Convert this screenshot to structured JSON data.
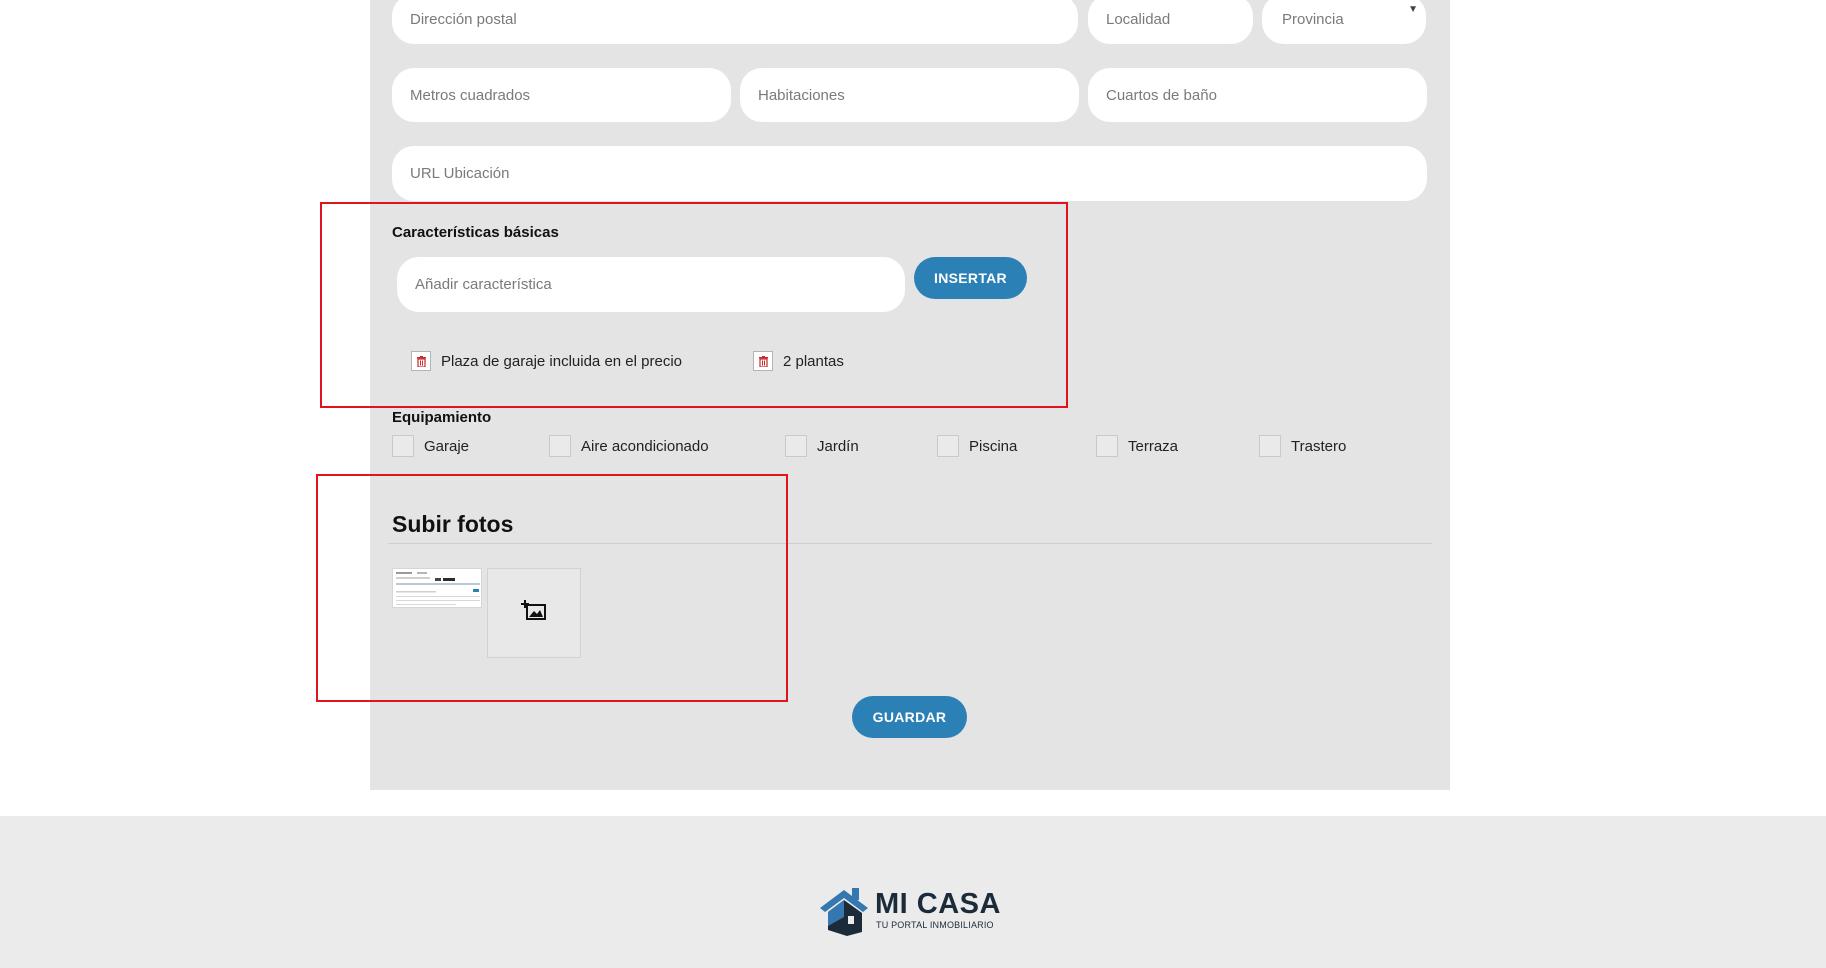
{
  "form": {
    "address_placeholder": "Dirección postal",
    "locality_placeholder": "Localidad",
    "province_selected": "Provincia",
    "sqm_placeholder": "Metros cuadrados",
    "rooms_placeholder": "Habitaciones",
    "bathrooms_placeholder": "Cuartos de baño",
    "url_placeholder": "URL Ubicación"
  },
  "features": {
    "title": "Características básicas",
    "input_placeholder": "Añadir característica",
    "insert_label": "INSERTAR",
    "items": [
      "Plaza de garaje incluida en el precio",
      "2 plantas"
    ]
  },
  "equipment": {
    "title": "Equipamiento",
    "options": [
      "Garaje",
      "Aire acondicionado",
      "Jardín",
      "Piscina",
      "Terraza",
      "Trastero"
    ]
  },
  "photos": {
    "title": "Subir fotos",
    "upload_icon": "add-photo-icon"
  },
  "save_label": "GUARDAR",
  "footer": {
    "logo_name": "MI CASA",
    "logo_tagline": "TU PORTAL INMOBILIARIO"
  },
  "colors": {
    "accent": "#2b80b6",
    "panel": "#e4e4e5",
    "highlight": "#e0141e",
    "logo_blue": "#3577b0",
    "logo_dark": "#1c2b3a"
  }
}
